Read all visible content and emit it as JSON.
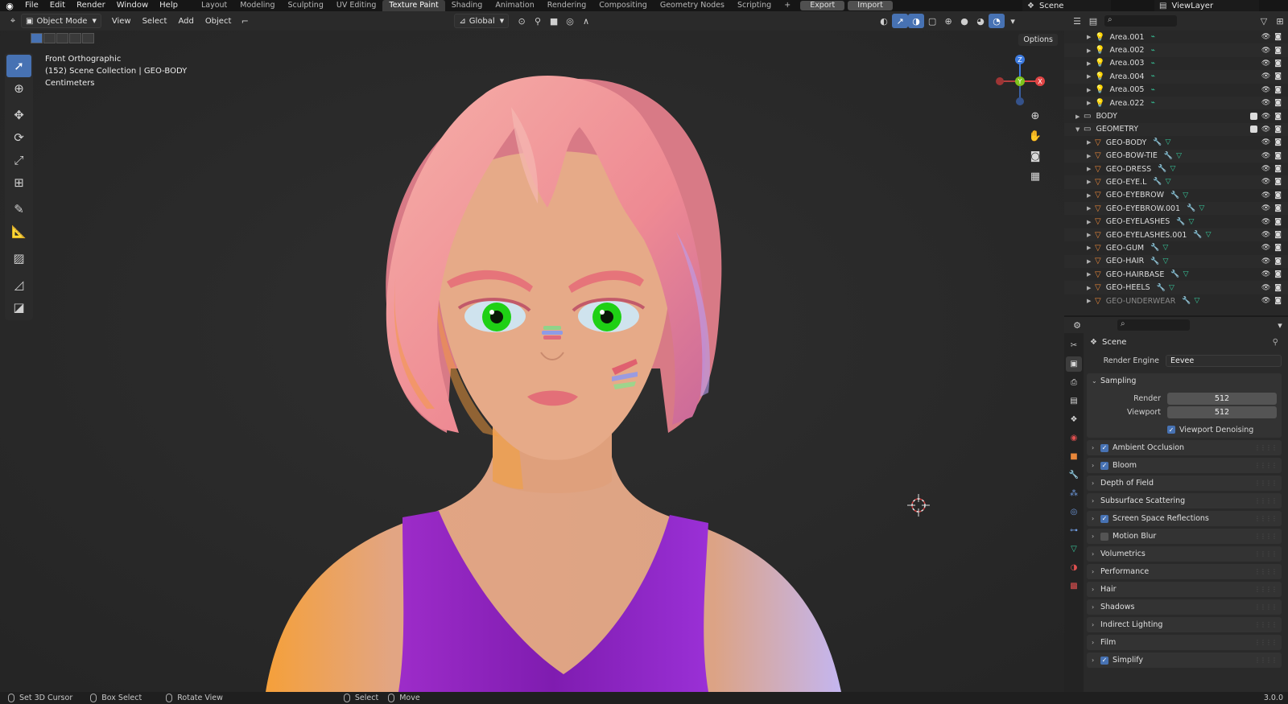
{
  "topbar": {
    "menus": [
      "File",
      "Edit",
      "Render",
      "Window",
      "Help"
    ],
    "workspaces": [
      "Layout",
      "Modeling",
      "Sculpting",
      "UV Editing",
      "Texture Paint",
      "Shading",
      "Animation",
      "Rendering",
      "Compositing",
      "Geometry Nodes",
      "Scripting"
    ],
    "active_workspace": "Texture Paint",
    "add_tab": "+",
    "export_label": "Export",
    "import_label": "Import",
    "scene_name": "Scene",
    "view_layer": "ViewLayer"
  },
  "viewport_header": {
    "mode": "Object Mode",
    "menus": [
      "View",
      "Select",
      "Add",
      "Object"
    ],
    "orientation": "Global",
    "options": "Options"
  },
  "viewport": {
    "view_name": "Front Orthographic",
    "collection_info": "(152) Scene Collection | GEO-BODY",
    "units": "Centimeters",
    "gizmo_axes": {
      "x": "X",
      "y": "Y",
      "z": "Z"
    }
  },
  "outliner": {
    "rows": [
      {
        "name": "Area.001",
        "type": "light",
        "indent": 1
      },
      {
        "name": "Area.002",
        "type": "light",
        "indent": 1
      },
      {
        "name": "Area.003",
        "type": "light",
        "indent": 1
      },
      {
        "name": "Area.004",
        "type": "light",
        "indent": 1
      },
      {
        "name": "Area.005",
        "type": "light",
        "indent": 1
      },
      {
        "name": "Area.022",
        "type": "light",
        "indent": 1
      },
      {
        "name": "BODY",
        "type": "collection",
        "indent": 0
      },
      {
        "name": "GEOMETRY",
        "type": "collection",
        "indent": 0,
        "expanded": true
      },
      {
        "name": "GEO-BODY",
        "type": "mesh",
        "indent": 1
      },
      {
        "name": "GEO-BOW-TIE",
        "type": "mesh",
        "indent": 1
      },
      {
        "name": "GEO-DRESS",
        "type": "mesh",
        "indent": 1
      },
      {
        "name": "GEO-EYE.L",
        "type": "mesh",
        "indent": 1
      },
      {
        "name": "GEO-EYEBROW",
        "type": "mesh",
        "indent": 1
      },
      {
        "name": "GEO-EYEBROW.001",
        "type": "mesh",
        "indent": 1
      },
      {
        "name": "GEO-EYELASHES",
        "type": "mesh",
        "indent": 1
      },
      {
        "name": "GEO-EYELASHES.001",
        "type": "mesh",
        "indent": 1
      },
      {
        "name": "GEO-GUM",
        "type": "mesh",
        "indent": 1
      },
      {
        "name": "GEO-HAIR",
        "type": "mesh",
        "indent": 1
      },
      {
        "name": "GEO-HAIRBASE",
        "type": "mesh",
        "indent": 1
      },
      {
        "name": "GEO-HEELS",
        "type": "mesh",
        "indent": 1
      },
      {
        "name": "GEO-UNDERWEAR",
        "type": "mesh",
        "indent": 1,
        "dim": true
      }
    ]
  },
  "properties": {
    "title": "Scene",
    "render_engine_label": "Render Engine",
    "render_engine_value": "Eevee",
    "sampling": {
      "label": "Sampling",
      "render_label": "Render",
      "render_value": "512",
      "viewport_label": "Viewport",
      "viewport_value": "512",
      "denoise_label": "Viewport Denoising"
    },
    "panels": [
      {
        "label": "Ambient Occlusion",
        "checkbox": "on"
      },
      {
        "label": "Bloom",
        "checkbox": "on"
      },
      {
        "label": "Depth of Field",
        "checkbox": "none"
      },
      {
        "label": "Subsurface Scattering",
        "checkbox": "none"
      },
      {
        "label": "Screen Space Reflections",
        "checkbox": "on"
      },
      {
        "label": "Motion Blur",
        "checkbox": "off"
      },
      {
        "label": "Volumetrics",
        "checkbox": "none"
      },
      {
        "label": "Performance",
        "checkbox": "none"
      },
      {
        "label": "Hair",
        "checkbox": "none"
      },
      {
        "label": "Shadows",
        "checkbox": "none"
      },
      {
        "label": "Indirect Lighting",
        "checkbox": "none"
      },
      {
        "label": "Film",
        "checkbox": "none"
      },
      {
        "label": "Simplify",
        "checkbox": "on"
      }
    ]
  },
  "statusbar": {
    "items": [
      "Set 3D Cursor",
      "Box Select",
      "Rotate View",
      "Select",
      "Move"
    ],
    "version": "3.0.0"
  },
  "colors": {
    "accent": "#4772b3",
    "skin": "#e2a583",
    "hair": "#f08a92",
    "dress": "#8b1fb8",
    "eyes": "#1fd015"
  }
}
